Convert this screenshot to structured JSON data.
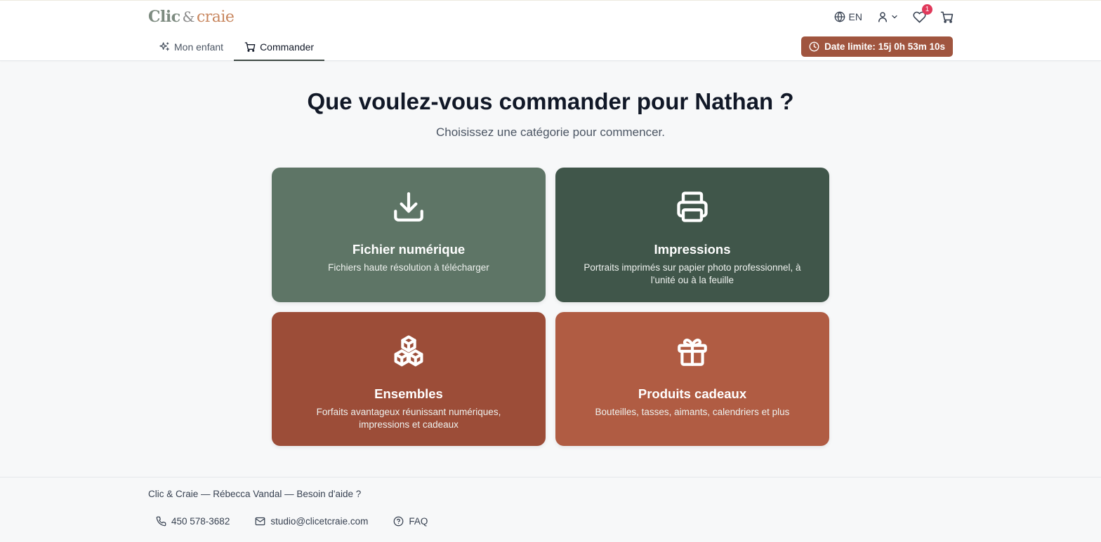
{
  "header": {
    "logo_part1": "Clic",
    "logo_amp": "&",
    "logo_part2": "craie",
    "language": "EN",
    "wishlist_count": "1",
    "tabs": [
      {
        "label": "Mon enfant",
        "icon": "sparkles-icon",
        "active": false
      },
      {
        "label": "Commander",
        "icon": "cart-icon",
        "active": true
      }
    ],
    "deadline_label": "Date limite: 15j 0h 53m 10s"
  },
  "main": {
    "title": "Que voulez-vous commander pour Nathan ?",
    "subtitle": "Choisissez une catégorie pour commencer.",
    "categories": [
      {
        "title": "Fichier numérique",
        "description": "Fichiers haute résolution à télécharger",
        "icon": "download-icon",
        "color": "#5e7566"
      },
      {
        "title": "Impressions",
        "description": "Portraits imprimés sur papier photo professionnel, à l'unité ou à la feuille",
        "icon": "printer-icon",
        "color": "#40564a"
      },
      {
        "title": "Ensembles",
        "description": "Forfaits avantageux réunissant numériques, impressions et cadeaux",
        "icon": "boxes-icon",
        "color": "#9c4d38"
      },
      {
        "title": "Produits cadeaux",
        "description": "Bouteilles, tasses, aimants, calendriers et plus",
        "icon": "gift-icon",
        "color": "#b05c43"
      }
    ]
  },
  "footer": {
    "info": "Clic & Craie — Rébecca Vandal — Besoin d'aide ?",
    "phone": "450 578-3682",
    "email": "studio@clicetcraie.com",
    "faq": "FAQ"
  },
  "colors": {
    "accent_deadline": "#a0553f",
    "badge": "#e0395a",
    "background": "#f7f8f9"
  }
}
